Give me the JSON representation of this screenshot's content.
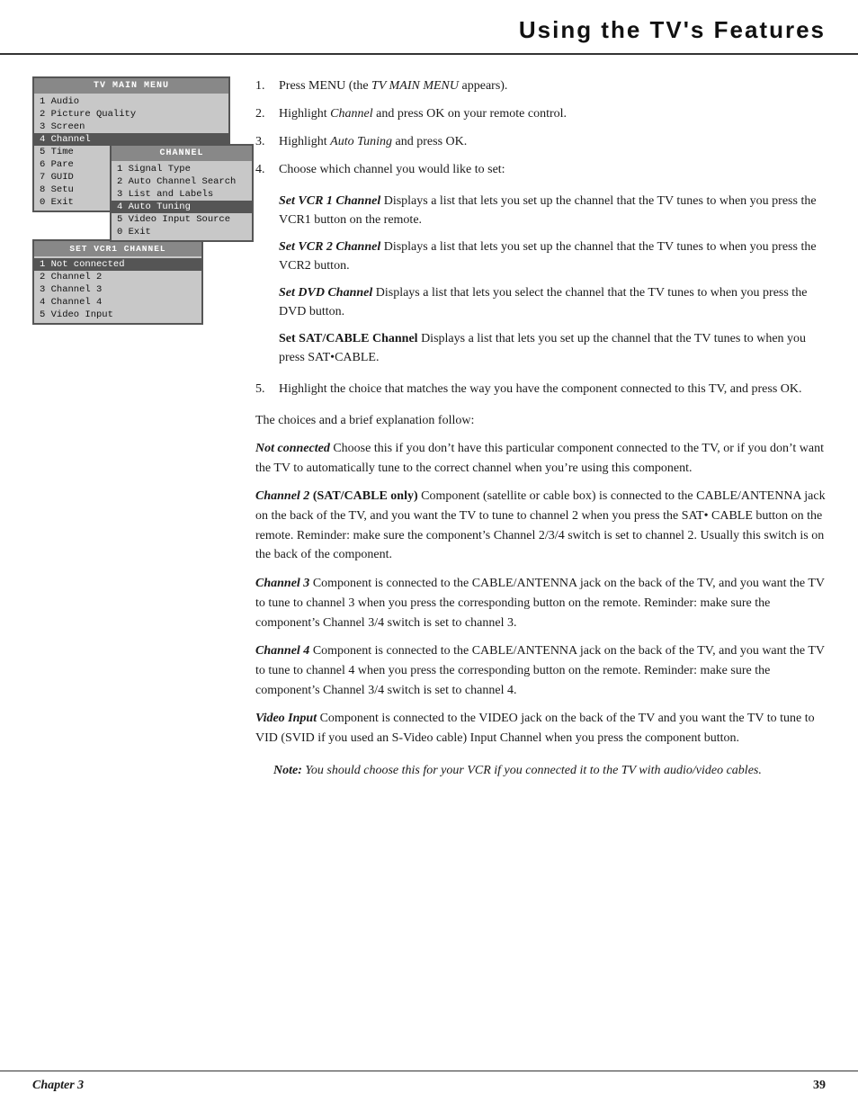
{
  "header": {
    "title": "Using the TV's Features"
  },
  "tv_main_menu": {
    "title": "TV MAIN MENU",
    "items": [
      {
        "label": "1 Audio",
        "highlighted": false
      },
      {
        "label": "2 Picture Quality",
        "highlighted": false
      },
      {
        "label": "3 Screen",
        "highlighted": false
      },
      {
        "label": "4 Channel",
        "highlighted": true
      },
      {
        "label": "5 Time",
        "highlighted": false
      },
      {
        "label": "6 Pare",
        "highlighted": false
      },
      {
        "label": "7 GUID",
        "highlighted": false
      },
      {
        "label": "8 Setu",
        "highlighted": false
      },
      {
        "label": "0 Exit",
        "highlighted": false
      }
    ]
  },
  "channel_menu": {
    "title": "CHANNEL",
    "items": [
      {
        "label": "1 Signal Type",
        "highlighted": false
      },
      {
        "label": "2 Auto Channel Search",
        "highlighted": false
      },
      {
        "label": "3 List and Labels",
        "highlighted": false
      },
      {
        "label": "4 Auto Tuning",
        "highlighted": true
      },
      {
        "label": "5 Video Input Source",
        "highlighted": false
      },
      {
        "label": "0 Exit",
        "highlighted": false
      }
    ]
  },
  "vcr1_menu": {
    "title": "SET VCR1 CHANNEL",
    "items": [
      {
        "label": "1 Not connected",
        "highlighted": true
      },
      {
        "label": "2 Channel 2",
        "highlighted": false
      },
      {
        "label": "3 Channel 3",
        "highlighted": false
      },
      {
        "label": "4 Channel 4",
        "highlighted": false
      },
      {
        "label": "5 Video Input",
        "highlighted": false
      }
    ]
  },
  "instructions": {
    "step1": "Press MENU (the",
    "step1_italic": "TV MAIN MENU",
    "step1_end": "appears).",
    "step2_start": "Highlight",
    "step2_italic": "Channel",
    "step2_end": "and press OK on your remote control.",
    "step3_start": "Highlight",
    "step3_italic": "Auto Tuning",
    "step3_end": "and press OK.",
    "step4": "Choose which channel you would like to set:",
    "vcr1_term": "Set VCR 1 Channel",
    "vcr1_desc": "Displays a list that lets you set up the channel that the TV tunes to when you press the VCR1 button on the remote.",
    "vcr2_term": "Set VCR 2 Channel",
    "vcr2_desc": "Displays a list that lets you set up the channel that the TV tunes to when you press the VCR2 button.",
    "dvd_term": "Set DVD Channel",
    "dvd_desc": "Displays a list that lets you select the channel that the TV tunes to when you press the DVD button.",
    "sat_term": "Set SAT/CABLE Channel",
    "sat_desc": "Displays a list that lets you set up the channel that the TV tunes to when you press SAT•CABLE.",
    "step5": "Highlight the choice that matches the way you have the component connected to this TV, and press OK."
  },
  "choices": {
    "intro": "The choices and a brief explanation follow:",
    "not_connected_term": "Not connected",
    "not_connected_desc": "Choose this if you don’t have this particular component connected to the TV, or if you don’t want the TV to automatically tune to the correct channel when you’re using this component.",
    "ch2_term": "Channel 2",
    "ch2_qualifier": "(SAT/CABLE only)",
    "ch2_desc": "Component (satellite or cable box) is connected to the CABLE/ANTENNA jack on the back of the TV, and you want the TV to tune to channel 2 when you press the SAT• CABLE button on the remote. Reminder: make sure the component’s Channel 2/3/4 switch is set to channel 2. Usually this switch is on the back of the component.",
    "ch3_term": "Channel 3",
    "ch3_desc": "Component is connected to the CABLE/ANTENNA jack on the back of the TV, and you want the TV to tune to channel 3 when you press the corresponding button on the remote. Reminder: make sure the component’s Channel 3/4 switch is set to channel 3.",
    "ch4_term": "Channel 4",
    "ch4_desc": "Component is connected to the CABLE/ANTENNA jack on the back of the TV, and you want the TV to tune to channel 4 when you press the corresponding button on the remote. Reminder: make sure the component’s Channel 3/4 switch is set to channel 4.",
    "video_term": "Video Input",
    "video_desc": "Component is connected to the VIDEO jack on the back of the TV and you want the TV to tune to VID (SVID if you used an S-Video cable) Input Channel when you press the component button.",
    "note_label": "Note:",
    "note_text": "You should choose this for your VCR if you connected it to the TV with audio/video cables."
  },
  "footer": {
    "chapter": "Chapter 3",
    "page": "39"
  }
}
